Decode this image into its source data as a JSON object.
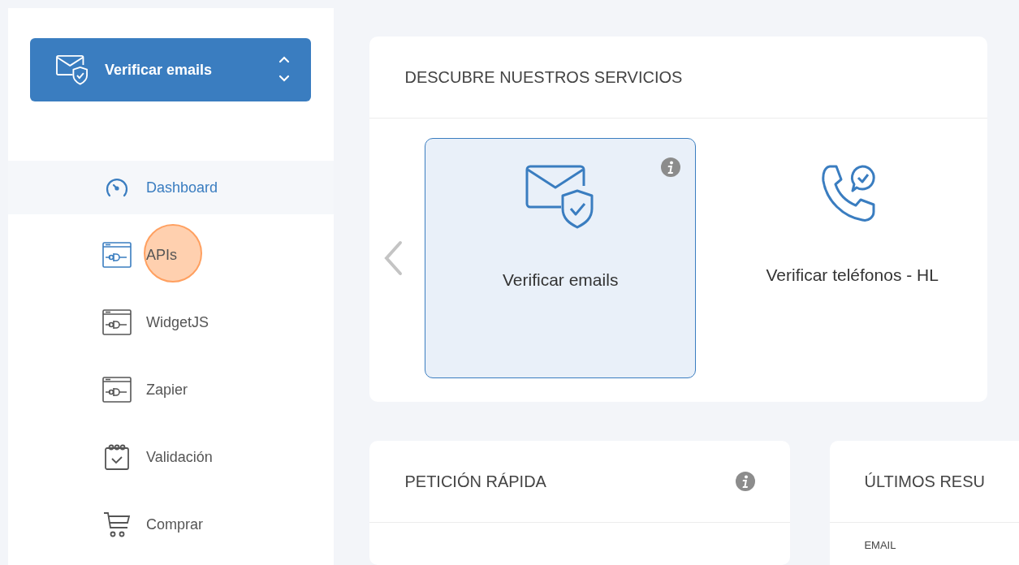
{
  "product_selector": {
    "label": "Verificar emails"
  },
  "sidebar": {
    "items": [
      {
        "label": "Dashboard",
        "kind": "gauge",
        "selected": true,
        "highlighted": false
      },
      {
        "label": "APIs",
        "kind": "plug",
        "selected": false,
        "highlighted": true
      },
      {
        "label": "WidgetJS",
        "kind": "plug",
        "selected": false,
        "highlighted": false
      },
      {
        "label": "Zapier",
        "kind": "plug",
        "selected": false,
        "highlighted": false
      },
      {
        "label": "Validación",
        "kind": "calendar",
        "selected": false,
        "highlighted": false
      },
      {
        "label": "Comprar",
        "kind": "cart",
        "selected": false,
        "highlighted": false
      }
    ]
  },
  "services_card": {
    "title": "DESCUBRE NUESTROS SERVICIOS",
    "services": [
      {
        "label": "Verificar emails",
        "kind": "email",
        "selected": true
      },
      {
        "label": "Verificar teléfonos - HL",
        "kind": "phone",
        "selected": false
      }
    ]
  },
  "quick_request_card": {
    "title": "PETICIÓN RÁPIDA"
  },
  "results_card": {
    "title": "ÚLTIMOS RESU",
    "column_1": "EMAIL"
  }
}
